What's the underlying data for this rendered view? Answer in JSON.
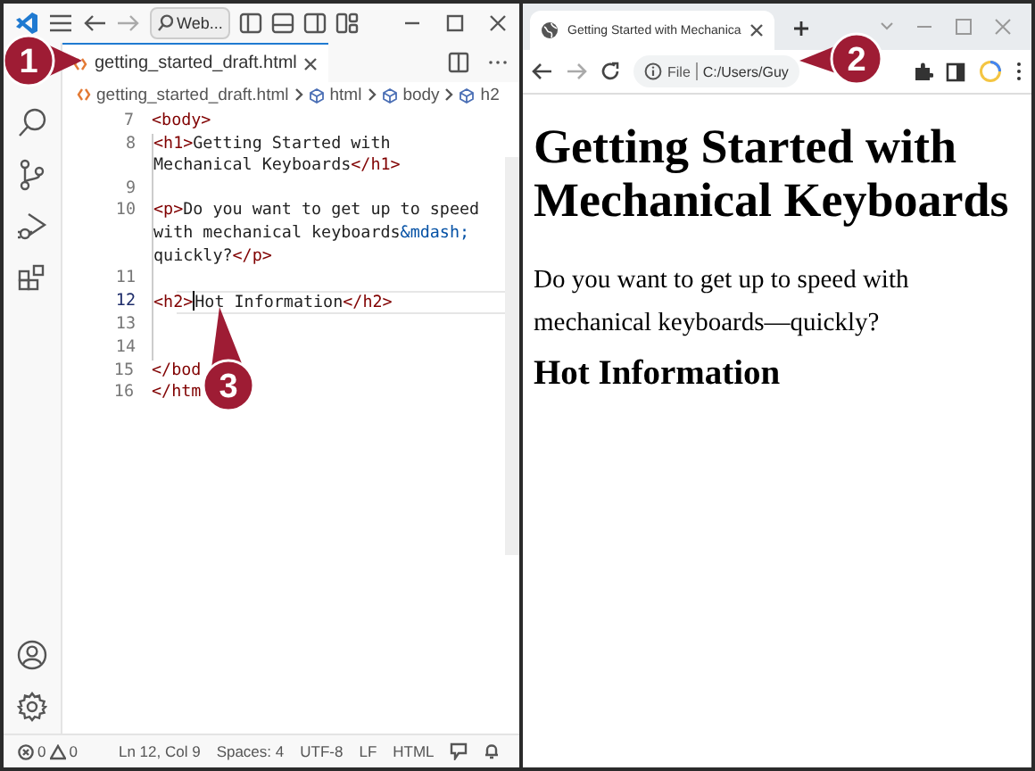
{
  "editor_window": {
    "search": "Web...",
    "tab": {
      "label": "getting_started_draft.html",
      "selected": true
    },
    "breadcrumb": [
      "getting_started_draft.html",
      "html",
      "body",
      "h2"
    ],
    "code_lines": [
      {
        "number": "7",
        "current": false,
        "rows": [
          [
            {
              "kind": "tag",
              "text": "<body>"
            }
          ]
        ],
        "children": [
          {
            "number": "8",
            "current": false,
            "rows": [
              [
                {
                  "kind": "tag",
                  "text": "<h1>"
                },
                {
                  "kind": "text",
                  "text": "Getting Started with"
                }
              ],
              [
                {
                  "kind": "text",
                  "text": "Mechanical Keyboards"
                },
                {
                  "kind": "tag",
                  "text": "</h1>"
                }
              ]
            ]
          },
          {
            "number": "9",
            "current": false
          },
          {
            "number": "10",
            "current": false,
            "rows": [
              [
                {
                  "kind": "tag",
                  "text": "<p>"
                },
                {
                  "kind": "text",
                  "text": "Do you want to get up to speed"
                }
              ],
              [
                {
                  "kind": "text",
                  "text": "with mechanical keyboards"
                },
                {
                  "kind": "entity",
                  "text": "&mdash;"
                }
              ],
              [
                {
                  "kind": "text",
                  "text": "quickly?"
                },
                {
                  "kind": "tag",
                  "text": "</p>"
                }
              ]
            ]
          },
          {
            "number": "11",
            "current": false
          },
          {
            "number": "12",
            "current": true,
            "rows": [
              [
                {
                  "kind": "tag",
                  "text": "<h2>"
                },
                {
                  "kind": "text",
                  "text": "Hot Information"
                },
                {
                  "kind": "tag",
                  "text": "</h2>"
                }
              ]
            ]
          },
          {
            "number": "13",
            "current": false
          },
          {
            "number": "14",
            "current": false
          }
        ]
      },
      {
        "number": "15",
        "current": false,
        "rows": [
          [
            {
              "kind": "tag",
              "text": "</bod"
            }
          ]
        ]
      },
      {
        "number": "16",
        "current": false,
        "rows": [
          [
            {
              "kind": "tag",
              "text": "</htm"
            }
          ]
        ]
      }
    ],
    "status_bar": {
      "errors": "0",
      "warnings": "0",
      "items": [
        "Ln 12, Col 9",
        "Spaces: 4",
        "UTF-8",
        "LF",
        "HTML"
      ]
    }
  },
  "browser_window": {
    "tab": {
      "title": "Getting Started with Mechanica",
      "selected": true
    },
    "address": {
      "scheme": "File",
      "url": "C:/Users/Guy"
    },
    "page": {
      "heading": "Getting Started with Mechanical Keyboards",
      "paragraph": "Do you want to get up to speed with mechanical keyboards—quickly?",
      "subheading": "Hot Information"
    }
  },
  "callouts": [
    {
      "label": "1"
    },
    {
      "label": "2"
    },
    {
      "label": "3"
    }
  ]
}
